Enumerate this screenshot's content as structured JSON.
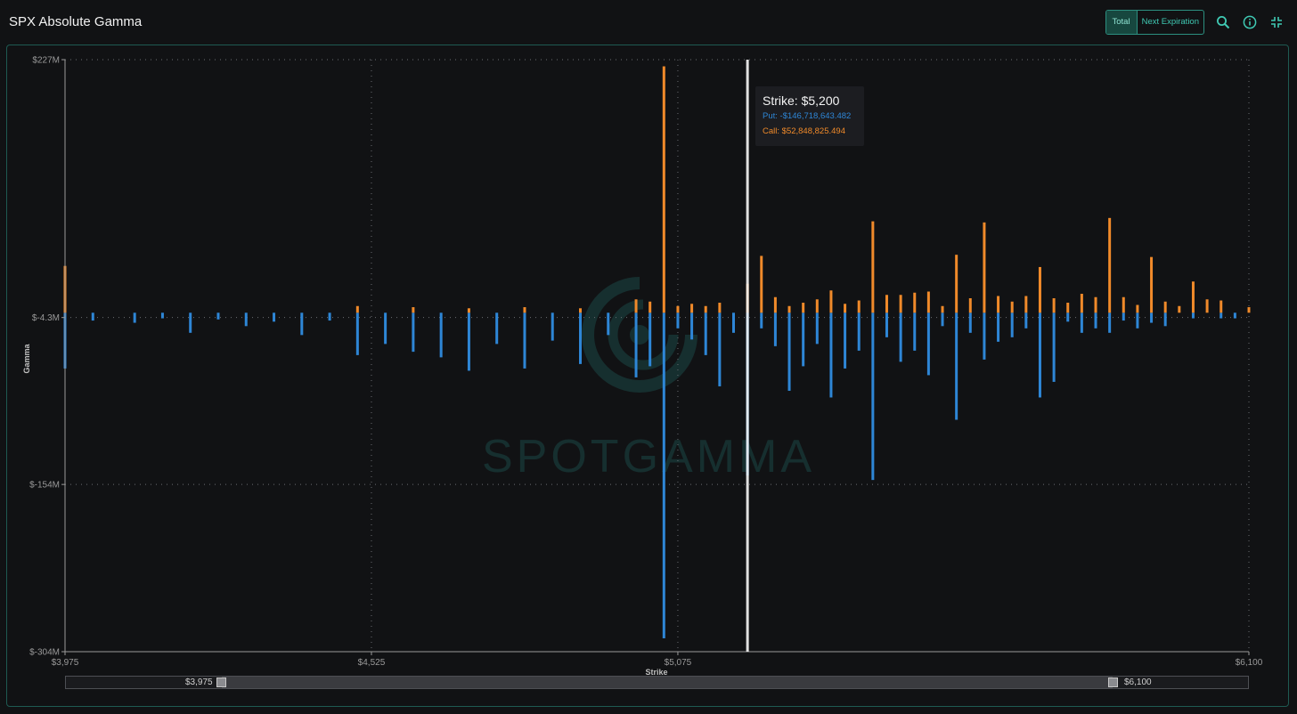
{
  "header": {
    "title": "SPX Absolute Gamma",
    "tabs": [
      {
        "label": "Total",
        "active": true
      },
      {
        "label": "Next Expiration",
        "active": false
      }
    ],
    "icons": [
      "search-icon",
      "info-icon",
      "collapse-icon"
    ]
  },
  "watermark": "SPOTGAMMA",
  "tooltip": {
    "title": "Strike: $5,200",
    "put_label": "Put:",
    "put_value": "-$146,718,643.482",
    "call_label": "Call:",
    "call_value": "$52,848,825.494"
  },
  "range_slider": {
    "low_label": "$3,975",
    "high_label": "$6,100"
  },
  "colors": {
    "put": "#2e86d6",
    "call": "#f08a2a",
    "accent": "#3fc9b3",
    "background": "#111214"
  },
  "chart_data": {
    "type": "bar",
    "xlabel": "Strike",
    "ylabel": "Gamma",
    "xlim": [
      3975,
      6100
    ],
    "ylim": [
      -304,
      227
    ],
    "units": "$M",
    "x_ticks": [
      3975,
      4525,
      5075,
      6100
    ],
    "x_tick_labels": [
      "$3,975",
      "$4,525",
      "$5,075",
      "$6,100"
    ],
    "y_ticks": [
      227,
      -4.3,
      -154,
      -304
    ],
    "y_tick_labels": [
      "$227M",
      "$-4.3M",
      "$-154M",
      "$-304M"
    ],
    "highlight_strike": 5200,
    "series": [
      {
        "name": "Call",
        "color": "#f08a2a",
        "x": [
          3975,
          4500,
          4600,
          4700,
          4800,
          4900,
          5000,
          5025,
          5050,
          5075,
          5100,
          5125,
          5150,
          5200,
          5225,
          5250,
          5275,
          5300,
          5325,
          5350,
          5375,
          5400,
          5425,
          5450,
          5475,
          5500,
          5525,
          5550,
          5575,
          5600,
          5625,
          5650,
          5675,
          5700,
          5725,
          5750,
          5775,
          5800,
          5825,
          5850,
          5875,
          5900,
          5925,
          5950,
          5975,
          6000,
          6025,
          6050,
          6100
        ],
        "y": [
          42,
          6,
          5,
          4,
          5,
          4,
          12,
          10,
          221,
          6,
          8,
          6,
          9,
          26,
          51,
          14,
          6,
          9,
          12,
          20,
          8,
          11,
          82,
          16,
          16,
          18,
          19,
          6,
          52,
          13,
          81,
          15,
          10,
          15,
          41,
          13,
          9,
          17,
          14,
          85,
          14,
          7,
          50,
          10,
          6,
          28,
          12,
          11,
          5
        ]
      },
      {
        "name": "Put",
        "color": "#2e86d6",
        "x": [
          3975,
          4025,
          4100,
          4150,
          4200,
          4250,
          4300,
          4350,
          4400,
          4450,
          4500,
          4550,
          4600,
          4650,
          4700,
          4750,
          4800,
          4850,
          4900,
          4950,
          5000,
          5025,
          5050,
          5075,
          5100,
          5125,
          5150,
          5175,
          5200,
          5225,
          5250,
          5275,
          5300,
          5325,
          5350,
          5375,
          5400,
          5425,
          5450,
          5475,
          5500,
          5525,
          5550,
          5575,
          5600,
          5625,
          5650,
          5675,
          5700,
          5725,
          5750,
          5775,
          5800,
          5825,
          5850,
          5875,
          5900,
          5925,
          5950,
          6000,
          6050,
          6075
        ],
        "y": [
          -50,
          -7,
          -9,
          -5,
          -18,
          -6,
          -12,
          -8,
          -20,
          -7,
          -38,
          -28,
          -35,
          -40,
          -52,
          -28,
          -50,
          -25,
          -46,
          -20,
          -58,
          -48,
          -292,
          -14,
          -24,
          -38,
          -66,
          -18,
          -146,
          -14,
          -30,
          -70,
          -48,
          -28,
          -76,
          -50,
          -34,
          -150,
          -22,
          -44,
          -34,
          -56,
          -12,
          -96,
          -18,
          -42,
          -26,
          -22,
          -14,
          -76,
          -62,
          -8,
          -18,
          -14,
          -18,
          -7,
          -14,
          -9,
          -12,
          -5,
          -5,
          -5
        ]
      }
    ]
  }
}
